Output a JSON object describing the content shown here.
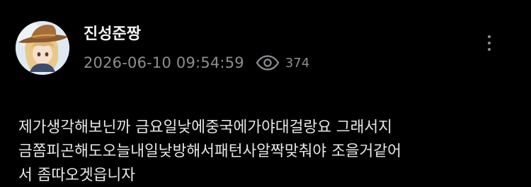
{
  "post": {
    "author": {
      "name": "진성준짱",
      "avatar_icon": "anime-character-avatar-icon"
    },
    "timestamp": "2026-06-10 09:54:59",
    "views": "374",
    "views_icon": "eye-icon",
    "menu_icon": "more-vertical-icon",
    "body_lines": [
      "제가생각해보닌까 금요일낮에중국에가야대걸랑요 그래서지",
      "금쫌피곤해도오늘내일낮방해서패턴사알짝맞춰야 조을거같어",
      "서 좀따오겟읍니자"
    ]
  },
  "colors": {
    "background": "#000000",
    "text_primary": "#e8e8e8",
    "text_secondary": "#8e8e93"
  }
}
